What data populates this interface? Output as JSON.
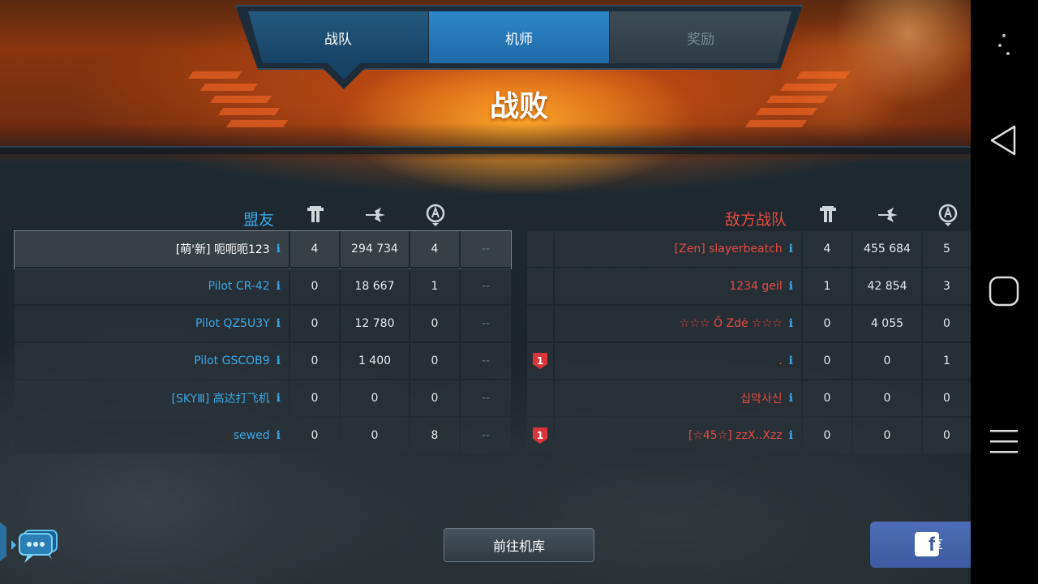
{
  "tabs": [
    {
      "label": "战队",
      "state": "selected"
    },
    {
      "label": "机师",
      "state": "active"
    },
    {
      "label": "奖励",
      "state": "disabled"
    }
  ],
  "result_title": "战败",
  "allies": {
    "title": "盟友",
    "rows": [
      {
        "name": "[萌'新] 呃呃呃123",
        "c1": "4",
        "c2": "294 734",
        "c3": "4",
        "c4": "--",
        "self": true
      },
      {
        "name": "Pilot CR-42",
        "c1": "0",
        "c2": "18 667",
        "c3": "1",
        "c4": "--"
      },
      {
        "name": "Pilot QZ5U3Y",
        "c1": "0",
        "c2": "12 780",
        "c3": "0",
        "c4": "--"
      },
      {
        "name": "Pilot GSCOB9",
        "c1": "0",
        "c2": "1 400",
        "c3": "0",
        "c4": "--"
      },
      {
        "name": "[SKYⅢ] 高达打飞机",
        "c1": "0",
        "c2": "0",
        "c3": "0",
        "c4": "--"
      },
      {
        "name": "sewed",
        "c1": "0",
        "c2": "0",
        "c3": "8",
        "c4": "--"
      }
    ]
  },
  "enemies": {
    "title": "敌方战队",
    "rows": [
      {
        "name": "[Zen] slayerbeatch",
        "badge": "",
        "c1": "4",
        "c2": "455 684",
        "c3": "5"
      },
      {
        "name": "1234 geil",
        "badge": "",
        "c1": "1",
        "c2": "42 854",
        "c3": "3"
      },
      {
        "name": "☆☆☆ Ő Zdė ☆☆☆",
        "badge": "",
        "c1": "0",
        "c2": "4 055",
        "c3": "0"
      },
      {
        "name": ".",
        "badge": "1",
        "c1": "0",
        "c2": "0",
        "c3": "1"
      },
      {
        "name": "십악사신",
        "badge": "",
        "c1": "0",
        "c2": "0",
        "c3": "0"
      },
      {
        "name": "[☆45☆] zzX..Xzz",
        "badge": "1",
        "c1": "0",
        "c2": "0",
        "c3": "0"
      }
    ]
  },
  "info_glyph": "i",
  "icons": {
    "col1": "flag-kills-icon",
    "col2": "damage-hit-icon",
    "col3": "assist-badge-icon",
    "chat": "chat-bubbles-icon",
    "facebook": "facebook-icon"
  },
  "buttons": {
    "hangar": "前往机库",
    "share": "分享"
  },
  "colors": {
    "ally": "#3ba7e6",
    "enemy": "#e24a43",
    "tab_active": "#2c86c8",
    "facebook": "#3c5aa0"
  }
}
